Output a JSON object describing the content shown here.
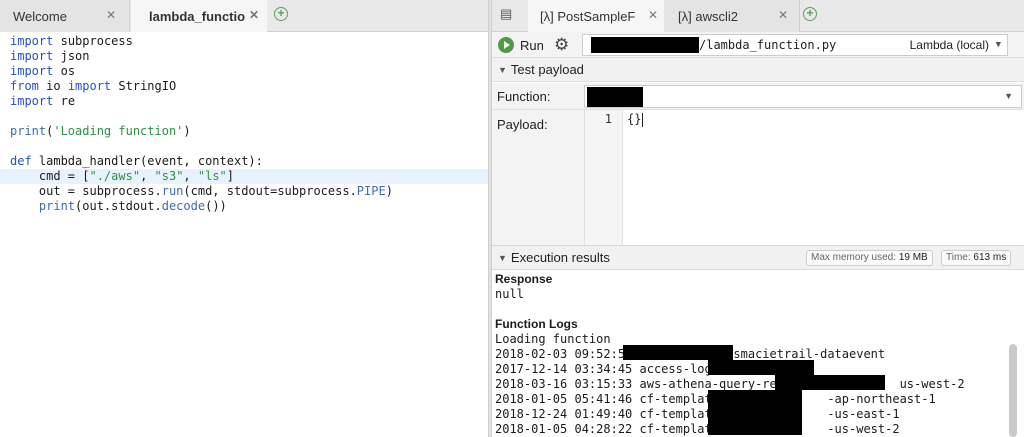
{
  "left_tabs": {
    "welcome_label": "Welcome",
    "lambda_label": "lambda_function",
    "close_glyph": "✕",
    "add_glyph": "+"
  },
  "code_lines": [
    "import subprocess",
    "import json",
    "import os",
    "from io import StringIO",
    "import re",
    "",
    "print('Loading function')",
    "",
    "def lambda_handler(event, context):",
    "    cmd = [\"./aws\", \"s3\", \"ls\"]",
    "    out = subprocess.run(cmd, stdout=subprocess.PIPE)",
    "    print(out.stdout.decode())"
  ],
  "right_tabs": {
    "post_label": "[λ] PostSampleF",
    "awscli_label": "[λ] awscli2",
    "close_glyph": "✕",
    "add_glyph": "+"
  },
  "toolbar": {
    "run_label": "Run",
    "path_suffix": "/lambda_function.py",
    "env_label": "Lambda (local)"
  },
  "test_payload": {
    "header": "Test payload",
    "function_label": "Function:",
    "payload_label": "Payload:",
    "line_number": "1",
    "payload_text": "{}"
  },
  "execution": {
    "header": "Execution results",
    "memory_label": "Max memory used:",
    "memory_value": "19 MB",
    "time_label": "Time:",
    "time_value": "613 ms",
    "response_title": "Response",
    "response_value": "null",
    "logs_title": "Function Logs",
    "logs": [
      "Loading function",
      "2018-02-03 09:52:55              smacietrail-dataevent",
      "2017-12-14 03:34:45 access-logs-",
      "2018-03-16 03:15:33 aws-athena-query-resul              us-west-2",
      "2018-01-05 05:41:46 cf-templates              -ap-northeast-1",
      "2018-12-24 01:49:40 cf-templates              -us-east-1",
      "2018-01-05 04:28:22 cf-templates              -us-west-2"
    ]
  },
  "icons": {
    "panel": "panel-toggle-icon",
    "gear": "gear-icon",
    "run": "run-icon"
  },
  "colors": {
    "keyword": "#2650c8",
    "string": "#2f8f43",
    "run_green": "#4f9a44",
    "highlight": "#e8f2fe"
  }
}
